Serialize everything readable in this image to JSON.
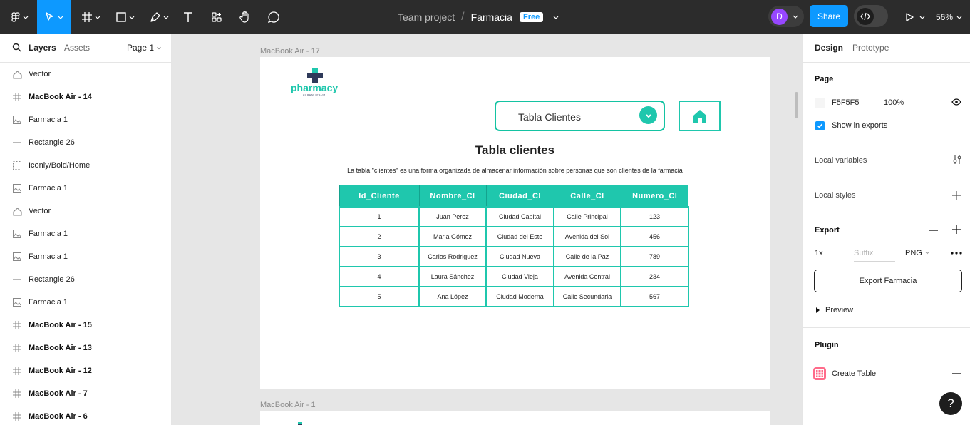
{
  "topbar": {
    "team": "Team project",
    "file": "Farmacia",
    "plan_badge": "Free",
    "avatar_initial": "D",
    "share_label": "Share",
    "zoom": "56%"
  },
  "left_panel": {
    "tabs": {
      "layers": "Layers",
      "assets": "Assets",
      "page": "Page 1"
    },
    "layers": [
      {
        "name": "Vector",
        "icon": "vector-icon",
        "bold": false
      },
      {
        "name": "MacBook Air - 14",
        "icon": "frame-icon",
        "bold": true
      },
      {
        "name": "Farmacia 1",
        "icon": "image-icon",
        "bold": false
      },
      {
        "name": "Rectangle 26",
        "icon": "line-icon",
        "bold": false
      },
      {
        "name": "Iconly/Bold/Home",
        "icon": "component-icon",
        "bold": false
      },
      {
        "name": "Farmacia 1",
        "icon": "image-icon",
        "bold": false
      },
      {
        "name": "Vector",
        "icon": "vector-icon",
        "bold": false
      },
      {
        "name": "Farmacia 1",
        "icon": "image-icon",
        "bold": false
      },
      {
        "name": "Farmacia 1",
        "icon": "image-icon",
        "bold": false
      },
      {
        "name": "Rectangle 26",
        "icon": "line-icon",
        "bold": false
      },
      {
        "name": "Farmacia 1",
        "icon": "image-icon",
        "bold": false
      },
      {
        "name": "MacBook Air - 15",
        "icon": "frame-icon",
        "bold": true
      },
      {
        "name": "MacBook Air - 13",
        "icon": "frame-icon",
        "bold": true
      },
      {
        "name": "MacBook Air - 12",
        "icon": "frame-icon",
        "bold": true
      },
      {
        "name": "MacBook Air - 7",
        "icon": "frame-icon",
        "bold": true
      },
      {
        "name": "MacBook Air - 6",
        "icon": "frame-icon",
        "bold": true
      }
    ]
  },
  "canvas": {
    "frame_top_label": "MacBook Air - 17",
    "frame_bottom_label": "MacBook Air - 1",
    "logo_text": "pharmacy",
    "logo_subtext": "LOREM IPSUM",
    "dropdown_label": "Tabla Clientes",
    "heading": "Tabla clientes",
    "description": "La tabla \"clientes\" es una forma organizada de almacenar información sobre personas que son clientes de la farmacia",
    "table": {
      "headers": [
        "Id_Cliente",
        "Nombre_Cl",
        "Ciudad_Cl",
        "Calle_Cl",
        "Numero_Cl"
      ],
      "rows": [
        [
          "1",
          "Juan Perez",
          "Ciudad Capital",
          "Calle Principal",
          "123"
        ],
        [
          "2",
          "Maria Gómez",
          "Ciudad del Este",
          "Avenida del Sol",
          "456"
        ],
        [
          "3",
          "Carlos Rodriguez",
          "Ciudad Nueva",
          "Calle de la Paz",
          "789"
        ],
        [
          "4",
          "Laura Sánchez",
          "Ciudad Vieja",
          "Avenida Central",
          "234"
        ],
        [
          "5",
          "Ana López",
          "Ciudad Moderna",
          "Calle Secundaria",
          "567"
        ]
      ]
    },
    "accent_color": "#1fc7ad"
  },
  "right_panel": {
    "tabs": {
      "design": "Design",
      "prototype": "Prototype"
    },
    "page": {
      "title": "Page",
      "color": "F5F5F5",
      "opacity": "100%",
      "show_in_exports": "Show in exports"
    },
    "local_variables": "Local variables",
    "local_styles": "Local styles",
    "export": {
      "title": "Export",
      "scale": "1x",
      "suffix_placeholder": "Suffix",
      "format": "PNG",
      "button": "Export Farmacia",
      "preview": "Preview"
    },
    "plugin": {
      "title": "Plugin",
      "item": "Create Table"
    }
  }
}
